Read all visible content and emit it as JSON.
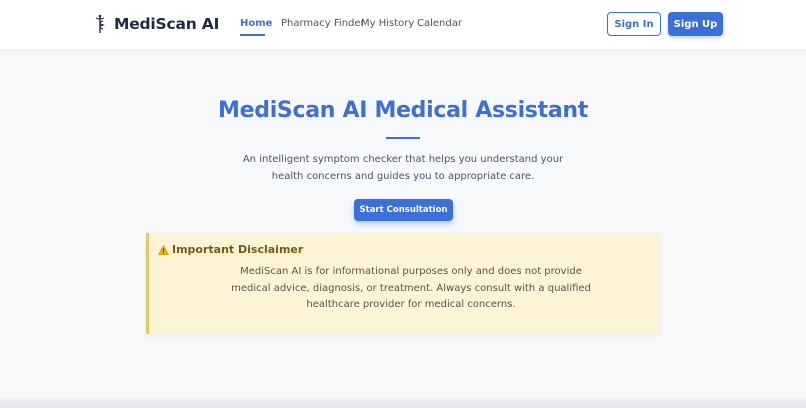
{
  "nav": {
    "brand": "MediScan AI",
    "links": [
      "Home",
      "Pharmacy Finder",
      "My History",
      "Calendar"
    ],
    "sign_in": "Sign In",
    "sign_up": "Sign Up"
  },
  "hero": {
    "title": "MediScan AI Medical Assistant",
    "description": "An intelligent symptom checker that helps you understand your health concerns and guides you to appropriate care.",
    "cta": "Start Consultation"
  },
  "disclaimer": {
    "title": "Important Disclaimer",
    "body": "MediScan AI is for informational purposes only and does not provide medical advice, diagnosis, or treatment. Always consult with a qualified healthcare provider for medical concerns."
  },
  "colors": {
    "accent": "#3b6fd9",
    "disclaimer_bg": "#fdf4d6",
    "disclaimer_border": "#e9c46a"
  },
  "icons": {
    "brand": "caduceus-icon",
    "disclaimer": "warning-icon"
  }
}
